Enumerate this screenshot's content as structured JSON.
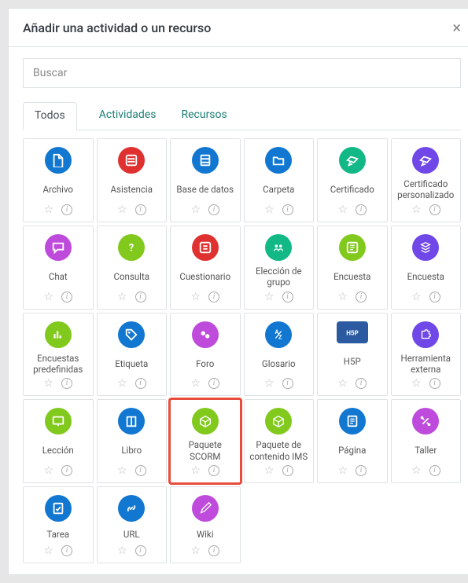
{
  "modal": {
    "title": "Añadir una actividad o un recurso"
  },
  "search": {
    "placeholder": "Buscar"
  },
  "tabs": {
    "all": "Todos",
    "activities": "Actividades",
    "resources": "Recursos",
    "active": "all"
  },
  "colors": {
    "blue": "#1177d1",
    "red": "#e03131",
    "fuchsia": "#be4bdb",
    "lime": "#94d82d",
    "green": "#82c91e",
    "orange": "#fd7e14",
    "teal": "#12b886",
    "purple": "#7048e8",
    "pink": "#e64980",
    "h5p": "#2c5aa0"
  },
  "items": [
    {
      "id": "archivo",
      "label": "Archivo",
      "color": "blue",
      "glyph": "file"
    },
    {
      "id": "asistencia",
      "label": "Asistencia",
      "color": "red",
      "glyph": "attendance"
    },
    {
      "id": "basedatos",
      "label": "Base de datos",
      "color": "blue",
      "glyph": "db"
    },
    {
      "id": "carpeta",
      "label": "Carpeta",
      "color": "blue",
      "glyph": "folder"
    },
    {
      "id": "certificado",
      "label": "Certificado",
      "color": "teal",
      "glyph": "cert"
    },
    {
      "id": "certpers",
      "label": "Certificado personalizado",
      "color": "purple",
      "glyph": "cert"
    },
    {
      "id": "chat",
      "label": "Chat",
      "color": "fuchsia",
      "glyph": "chat"
    },
    {
      "id": "consulta",
      "label": "Consulta",
      "color": "green",
      "glyph": "question"
    },
    {
      "id": "cuestionario",
      "label": "Cuestionario",
      "color": "red",
      "glyph": "list"
    },
    {
      "id": "eleccion",
      "label": "Elección de grupo",
      "color": "teal",
      "glyph": "groupchoice"
    },
    {
      "id": "encuesta1",
      "label": "Encuesta",
      "color": "green",
      "glyph": "survey"
    },
    {
      "id": "encuesta2",
      "label": "Encuesta",
      "color": "purple",
      "glyph": "stack"
    },
    {
      "id": "encpredef",
      "label": "Encuestas predefinidas",
      "color": "green",
      "glyph": "bars"
    },
    {
      "id": "etiqueta",
      "label": "Etiqueta",
      "color": "blue",
      "glyph": "tag"
    },
    {
      "id": "foro",
      "label": "Foro",
      "color": "fuchsia",
      "glyph": "forum"
    },
    {
      "id": "glosario",
      "label": "Glosario",
      "color": "blue",
      "glyph": "gloss"
    },
    {
      "id": "h5p",
      "label": "H5P",
      "color": "h5p",
      "glyph": "h5p"
    },
    {
      "id": "herrext",
      "label": "Herramienta externa",
      "color": "purple",
      "glyph": "puzzle"
    },
    {
      "id": "leccion",
      "label": "Lección",
      "color": "green",
      "glyph": "board"
    },
    {
      "id": "libro",
      "label": "Libro",
      "color": "blue",
      "glyph": "book"
    },
    {
      "id": "scorm",
      "label": "Paquete SCORM",
      "color": "green",
      "glyph": "box",
      "highlight": true
    },
    {
      "id": "ims",
      "label": "Paquete de contenido IMS",
      "color": "green",
      "glyph": "box"
    },
    {
      "id": "pagina",
      "label": "Página",
      "color": "blue",
      "glyph": "page"
    },
    {
      "id": "taller",
      "label": "Taller",
      "color": "fuchsia",
      "glyph": "tools"
    },
    {
      "id": "tarea",
      "label": "Tarea",
      "color": "blue",
      "glyph": "task"
    },
    {
      "id": "url",
      "label": "URL",
      "color": "blue",
      "glyph": "link"
    },
    {
      "id": "wiki",
      "label": "Wiki",
      "color": "fuchsia",
      "glyph": "edit"
    }
  ]
}
